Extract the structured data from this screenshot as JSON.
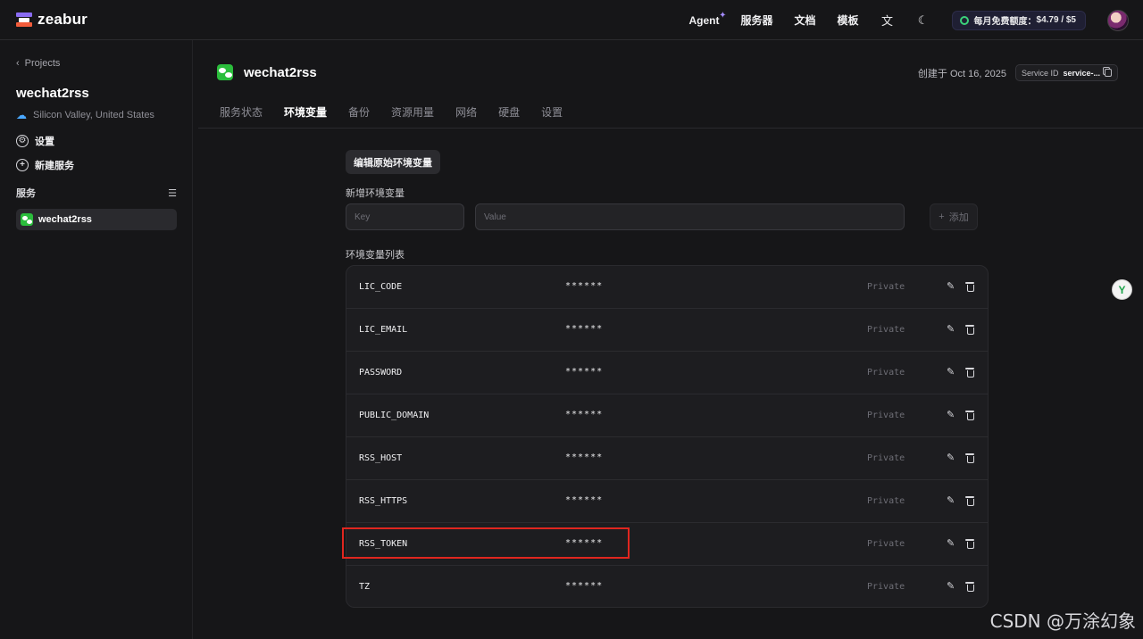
{
  "app": {
    "logo_text": "zeabur"
  },
  "topnav": {
    "agent": "Agent",
    "servers": "服务器",
    "docs": "文档",
    "templates": "模板",
    "quota_label": "每月免费额度：",
    "quota_value": "$4.79 / $5"
  },
  "sidebar": {
    "back": "Projects",
    "project_name": "wechat2rss",
    "region": "Silicon Valley, United States",
    "settings": "设置",
    "new_service": "新建服务",
    "section_title": "服务",
    "services": [
      {
        "name": "wechat2rss"
      }
    ]
  },
  "service": {
    "name": "wechat2rss",
    "created": "创建于 Oct 16, 2025",
    "service_id_label": "Service ID",
    "service_id_value": "service-..."
  },
  "tabs": [
    {
      "label": "服务状态",
      "active": false
    },
    {
      "label": "环境变量",
      "active": true
    },
    {
      "label": "备份",
      "active": false
    },
    {
      "label": "资源用量",
      "active": false
    },
    {
      "label": "网络",
      "active": false
    },
    {
      "label": "硬盘",
      "active": false
    },
    {
      "label": "设置",
      "active": false
    }
  ],
  "env": {
    "edit_raw": "编辑原始环境变量",
    "new_var_label": "新增环境变量",
    "key_placeholder": "Key",
    "value_placeholder": "Value",
    "add_label": "添加",
    "list_label": "环境变量列表",
    "variables": [
      {
        "key": "LIC_CODE",
        "value": "******",
        "visibility": "Private"
      },
      {
        "key": "LIC_EMAIL",
        "value": "******",
        "visibility": "Private"
      },
      {
        "key": "PASSWORD",
        "value": "******",
        "visibility": "Private"
      },
      {
        "key": "PUBLIC_DOMAIN",
        "value": "******",
        "visibility": "Private"
      },
      {
        "key": "RSS_HOST",
        "value": "******",
        "visibility": "Private"
      },
      {
        "key": "RSS_HTTPS",
        "value": "******",
        "visibility": "Private"
      },
      {
        "key": "RSS_TOKEN",
        "value": "******",
        "visibility": "Private"
      },
      {
        "key": "TZ",
        "value": "******",
        "visibility": "Private"
      }
    ]
  },
  "watermark": "CSDN @万涂幻象"
}
